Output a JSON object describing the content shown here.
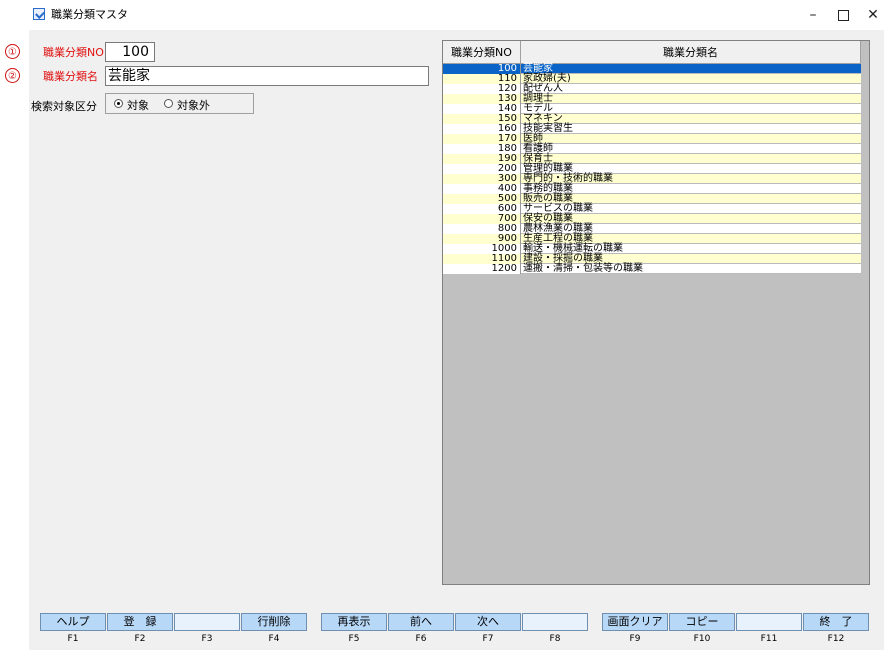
{
  "window": {
    "title": "職業分類マスタ",
    "controls": {
      "minimize": "–",
      "close": "✕"
    }
  },
  "markers": {
    "one": "①",
    "two": "②"
  },
  "form": {
    "no_label": "職業分類NO",
    "no_value": "100",
    "name_label": "職業分類名",
    "name_value": "芸能家",
    "search_label": "検索対象区分",
    "radio_target": "対象",
    "radio_exclude": "対象外",
    "radio_selected": "対象"
  },
  "grid": {
    "headers": {
      "no": "職業分類NO",
      "name": "職業分類名"
    },
    "rows": [
      {
        "no": "100",
        "name": "芸能家"
      },
      {
        "no": "110",
        "name": "家政婦(夫)"
      },
      {
        "no": "120",
        "name": "配ぜん人"
      },
      {
        "no": "130",
        "name": "調理士"
      },
      {
        "no": "140",
        "name": "モデル"
      },
      {
        "no": "150",
        "name": "マネキン"
      },
      {
        "no": "160",
        "name": "技能実習生"
      },
      {
        "no": "170",
        "name": "医師"
      },
      {
        "no": "180",
        "name": "看護師"
      },
      {
        "no": "190",
        "name": "保育士"
      },
      {
        "no": "200",
        "name": "管理的職業"
      },
      {
        "no": "300",
        "name": "専門的・技術的職業"
      },
      {
        "no": "400",
        "name": "事務的職業"
      },
      {
        "no": "500",
        "name": "販売の職業"
      },
      {
        "no": "600",
        "name": "サービスの職業"
      },
      {
        "no": "700",
        "name": "保安の職業"
      },
      {
        "no": "800",
        "name": "農林漁業の職業"
      },
      {
        "no": "900",
        "name": "生産工程の職業"
      },
      {
        "no": "1000",
        "name": "輸送・機械運転の職業"
      },
      {
        "no": "1100",
        "name": "建設・採掘の職業"
      },
      {
        "no": "1200",
        "name": "運搬・清掃・包装等の職業"
      }
    ]
  },
  "function_keys": [
    {
      "key": "F1",
      "label": "ヘルプ"
    },
    {
      "key": "F2",
      "label": "登　録"
    },
    {
      "key": "F3",
      "label": ""
    },
    {
      "key": "F4",
      "label": "行削除"
    },
    {
      "key": "F5",
      "label": "再表示"
    },
    {
      "key": "F6",
      "label": "前へ"
    },
    {
      "key": "F7",
      "label": "次へ"
    },
    {
      "key": "F8",
      "label": ""
    },
    {
      "key": "F9",
      "label": "画面クリア"
    },
    {
      "key": "F10",
      "label": "コピー"
    },
    {
      "key": "F11",
      "label": ""
    },
    {
      "key": "F12",
      "label": "終　了"
    }
  ],
  "colors": {
    "selected_row": "#0a64c8",
    "alt_row": "#ffffd0",
    "label_red": "#e01010",
    "fkey_button": "#b8d8f8"
  }
}
